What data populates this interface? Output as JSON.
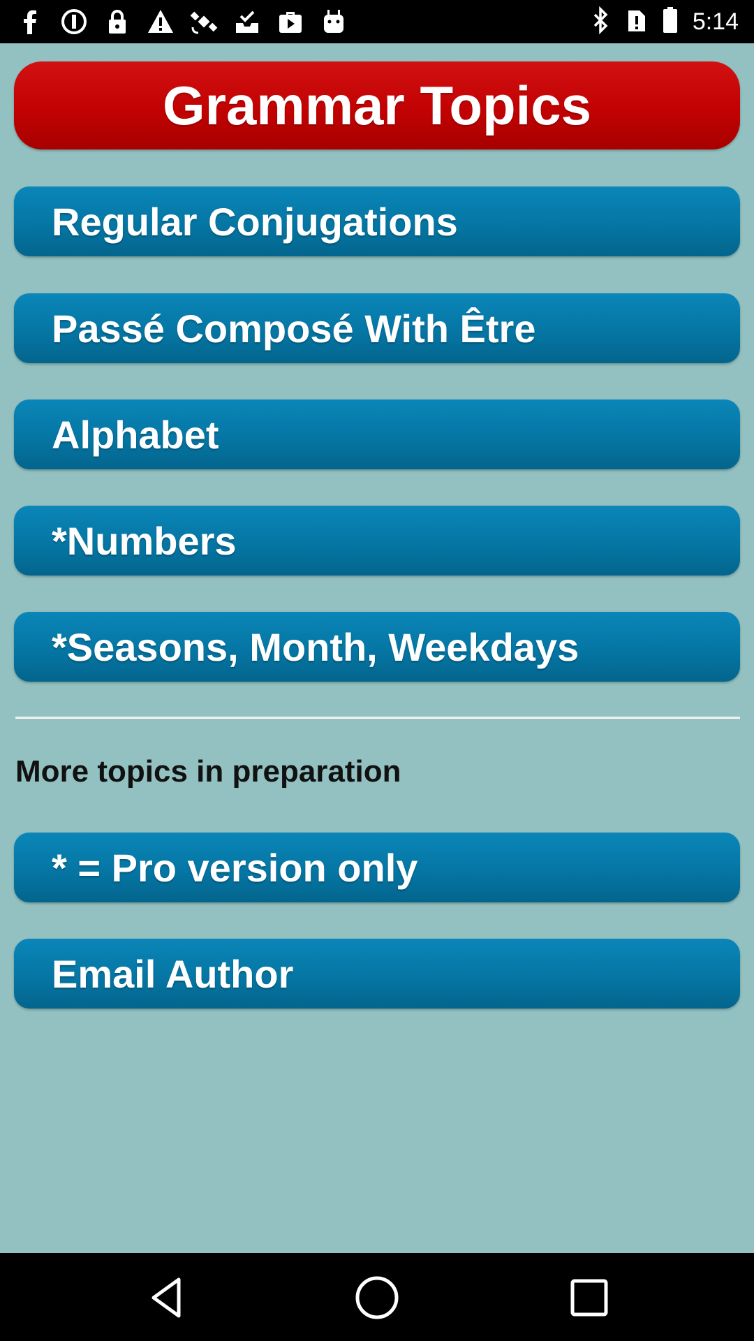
{
  "status_bar": {
    "time": "5:14",
    "icons_left": [
      "facebook-icon",
      "blocked-icon",
      "lock-icon",
      "warning-icon",
      "satellite-icon",
      "inbox-check-icon",
      "play-store-icon",
      "android-icon"
    ],
    "icons_right": [
      "bluetooth-icon",
      "no-sim-icon",
      "battery-icon"
    ]
  },
  "header": {
    "title": "Grammar Topics"
  },
  "topics": [
    {
      "label": "Regular Conjugations"
    },
    {
      "label": "Passé Composé With Être"
    },
    {
      "label": "Alphabet"
    },
    {
      "label": "*Numbers"
    },
    {
      "label": "*Seasons, Month, Weekdays"
    }
  ],
  "more_label": "More topics in preparation",
  "footer_buttons": [
    {
      "label": "* = Pro version only"
    },
    {
      "label": "Email Author"
    }
  ],
  "nav_bar": {
    "icons": [
      "back-icon",
      "home-icon",
      "recents-icon"
    ]
  },
  "colors": {
    "background": "#93c1c1",
    "title_red": "#c20202",
    "button_blue": "#0576a4"
  }
}
